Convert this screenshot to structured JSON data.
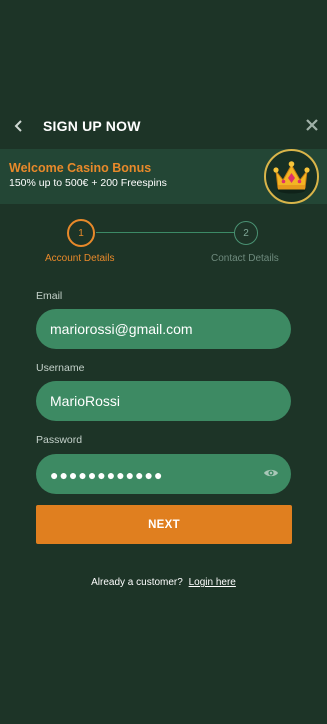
{
  "header": {
    "title": "SIGN UP NOW",
    "back_icon": "chevron-left-icon",
    "close_icon": "close-icon"
  },
  "bonus": {
    "title": "Welcome Casino Bonus",
    "subtitle": "150% up to 500€ + 200 Freespins",
    "image_icon": "crown-icon"
  },
  "stepper": {
    "steps": [
      {
        "number": "1",
        "label": "Account Details",
        "active": true
      },
      {
        "number": "2",
        "label": "Contact Details",
        "active": false
      }
    ]
  },
  "form": {
    "email": {
      "label": "Email",
      "value": "mariorossi@gmail.com"
    },
    "username": {
      "label": "Username",
      "value": "MarioRossi"
    },
    "password": {
      "label": "Password",
      "masked_value": "●●●●●●●●●●●●",
      "toggle_icon": "eye-icon"
    }
  },
  "next_label": "NEXT",
  "footer": {
    "prompt": "Already a customer?",
    "link": "Login here"
  },
  "colors": {
    "background": "#1d3427",
    "banner": "#234635",
    "field": "#3d8a63",
    "accent": "#e07f1f",
    "step_active": "#e8892a"
  }
}
